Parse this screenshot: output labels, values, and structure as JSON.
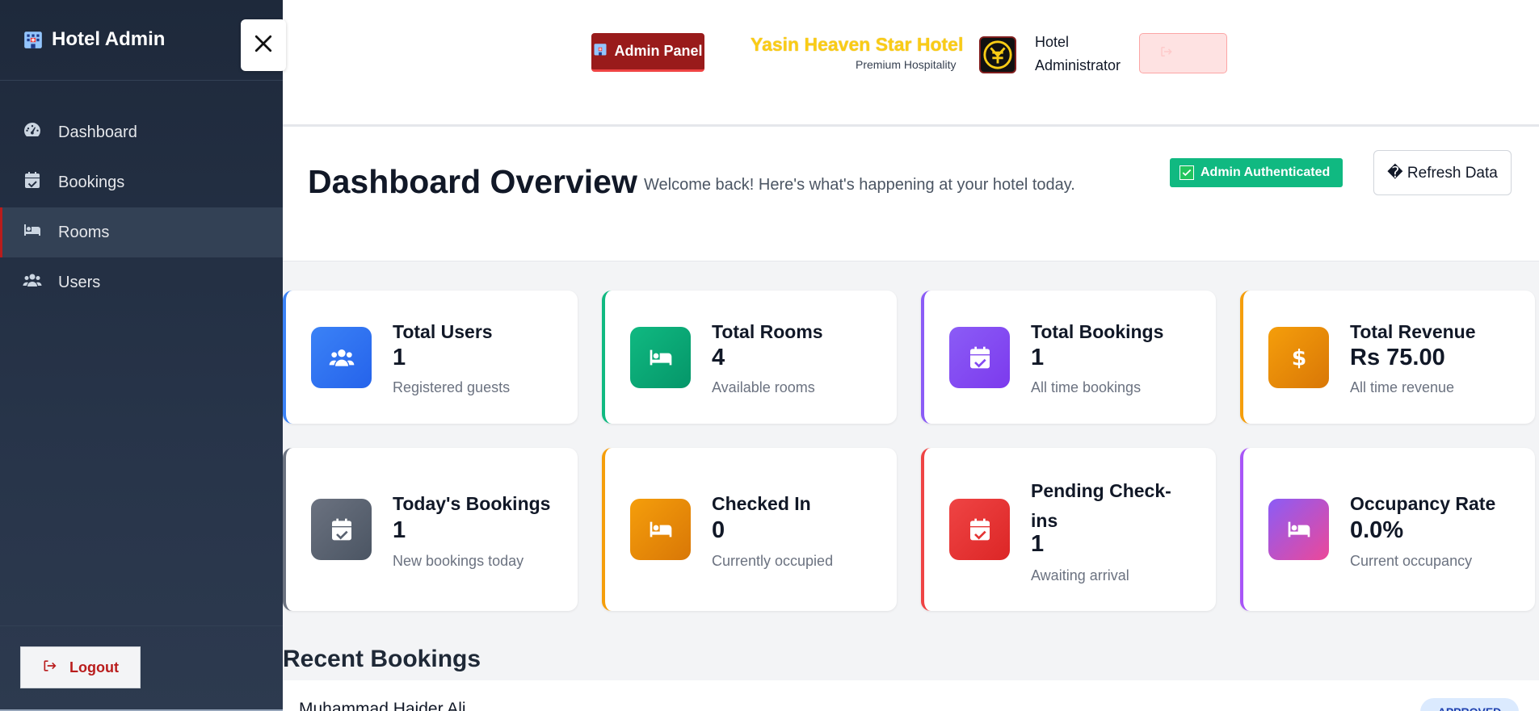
{
  "sidebar": {
    "brand": "Hotel Admin",
    "items": [
      {
        "label": "Dashboard",
        "icon": "dashboard-gauge-icon"
      },
      {
        "label": "Bookings",
        "icon": "calendar-check-icon"
      },
      {
        "label": "Rooms",
        "icon": "bed-icon",
        "active": true
      },
      {
        "label": "Users",
        "icon": "users-icon"
      }
    ],
    "logout_label": "Logout"
  },
  "topbar": {
    "admin_panel_label": "Admin Panel",
    "hotel_name": "Yasin Heaven Star Hotel",
    "hotel_tagline": "Premium Hospitality",
    "role_line1": "Hotel",
    "role_line2": "Administrator"
  },
  "overview": {
    "title": "Dashboard Overview",
    "subtitle": "Welcome back! Here's what's happening at your hotel today.",
    "auth_badge": "Admin Authenticated",
    "refresh_label": "� Refresh Data"
  },
  "stats": [
    {
      "label": "Total Users",
      "value": "1",
      "desc": "Registered guests",
      "color": "#3b82f6",
      "icon": "users-icon"
    },
    {
      "label": "Total Rooms",
      "value": "4",
      "desc": "Available rooms",
      "color": "#10b981",
      "icon": "bed-icon"
    },
    {
      "label": "Total Bookings",
      "value": "1",
      "desc": "All time bookings",
      "color": "#8b5cf6",
      "icon": "calendar-check-icon"
    },
    {
      "label": "Total Revenue",
      "value": "Rs 75.00",
      "desc": "All time revenue",
      "color": "#f59e0b",
      "icon": "dollar-icon"
    },
    {
      "label": "Today's Bookings",
      "value": "1",
      "desc": "New bookings today",
      "color": "#6b7280",
      "icon": "calendar-check-icon"
    },
    {
      "label": "Checked In",
      "value": "0",
      "desc": "Currently occupied",
      "color": "#f59e0b",
      "icon": "bed-icon"
    },
    {
      "label": "Pending Check-ins",
      "value": "1",
      "desc": "Awaiting arrival",
      "color": "#ef4444",
      "icon": "calendar-check-icon"
    },
    {
      "label": "Occupancy Rate",
      "value": "0.0%",
      "desc": "Current occupancy",
      "color": "#a855f7",
      "icon": "bed-icon"
    }
  ],
  "recent": {
    "title": "Recent Bookings",
    "first_guest": "Muhammad Haider Ali",
    "first_status": "APPROVED"
  }
}
